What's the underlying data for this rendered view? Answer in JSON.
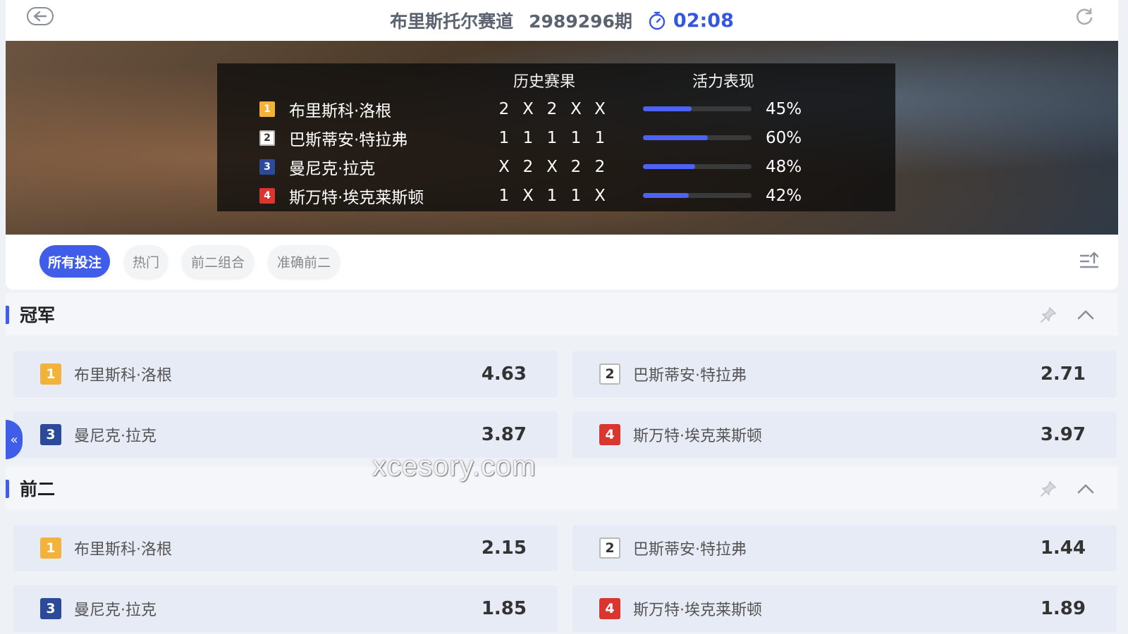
{
  "header": {
    "track": "布里斯托尔赛道",
    "period": "2989296期",
    "countdown": "02:08"
  },
  "stats": {
    "col_history": "历史赛果",
    "col_vitality": "活力表现",
    "rows": [
      {
        "num": "1",
        "name": "布里斯科·洛根",
        "history": [
          "2",
          "X",
          "2",
          "X",
          "X"
        ],
        "vitality_pct": 45,
        "vitality": "45%"
      },
      {
        "num": "2",
        "name": "巴斯蒂安·特拉弗",
        "history": [
          "1",
          "1",
          "1",
          "1",
          "1"
        ],
        "vitality_pct": 60,
        "vitality": "60%"
      },
      {
        "num": "3",
        "name": "曼尼克·拉克",
        "history": [
          "X",
          "2",
          "X",
          "2",
          "2"
        ],
        "vitality_pct": 48,
        "vitality": "48%"
      },
      {
        "num": "4",
        "name": "斯万特·埃克莱斯顿",
        "history": [
          "1",
          "X",
          "1",
          "1",
          "X"
        ],
        "vitality_pct": 42,
        "vitality": "42%"
      }
    ]
  },
  "tabs": [
    "所有投注",
    "热门",
    "前二组合",
    "准确前二"
  ],
  "sections": [
    {
      "title": "冠军",
      "entries": [
        {
          "num": "1",
          "name": "布里斯科·洛根",
          "odds": "4.63"
        },
        {
          "num": "2",
          "name": "巴斯蒂安·特拉弗",
          "odds": "2.71"
        },
        {
          "num": "3",
          "name": "曼尼克·拉克",
          "odds": "3.87"
        },
        {
          "num": "4",
          "name": "斯万特·埃克莱斯顿",
          "odds": "3.97"
        }
      ]
    },
    {
      "title": "前二",
      "entries": [
        {
          "num": "1",
          "name": "布里斯科·洛根",
          "odds": "2.15"
        },
        {
          "num": "2",
          "name": "巴斯蒂安·特拉弗",
          "odds": "1.44"
        },
        {
          "num": "3",
          "name": "曼尼克·拉克",
          "odds": "1.85"
        },
        {
          "num": "4",
          "name": "斯万特·埃克莱斯顿",
          "odds": "1.89"
        }
      ]
    }
  ],
  "side_tab": "«",
  "watermark": "xcesory.com",
  "colors": {
    "accent": "#3f5de8",
    "badge1": "#f3b23a",
    "badge3": "#2c4a9a",
    "badge4": "#d8362f"
  }
}
